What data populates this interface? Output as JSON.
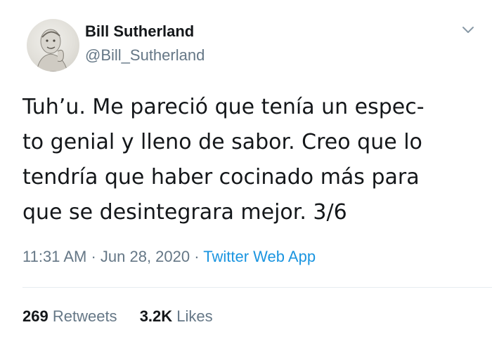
{
  "tweet": {
    "author": {
      "name": "Bill Sutherland",
      "handle": "@Bill_Sutherland"
    },
    "text_lines": [
      "Tuh’u. Me pareció que tenía un espec-",
      "to genial y lleno de sabor. Creo que lo",
      "tendría que haber cocinado más para",
      "que se desintegrara mejor. 3/6"
    ],
    "time": "11:31 AM",
    "separator": " · ",
    "date": "Jun 28, 2020",
    "app": "Twitter Web App",
    "stats": {
      "retweets_count": "269",
      "retweets_label": "Retweets",
      "likes_count": "3.2K",
      "likes_label": "Likes"
    }
  },
  "icons": {
    "menu": "chevron-down-icon",
    "avatar": "avatar"
  },
  "colors": {
    "text": "#14171a",
    "secondary": "#657786",
    "link": "#1b95e0",
    "divider": "#e6ecf0"
  }
}
